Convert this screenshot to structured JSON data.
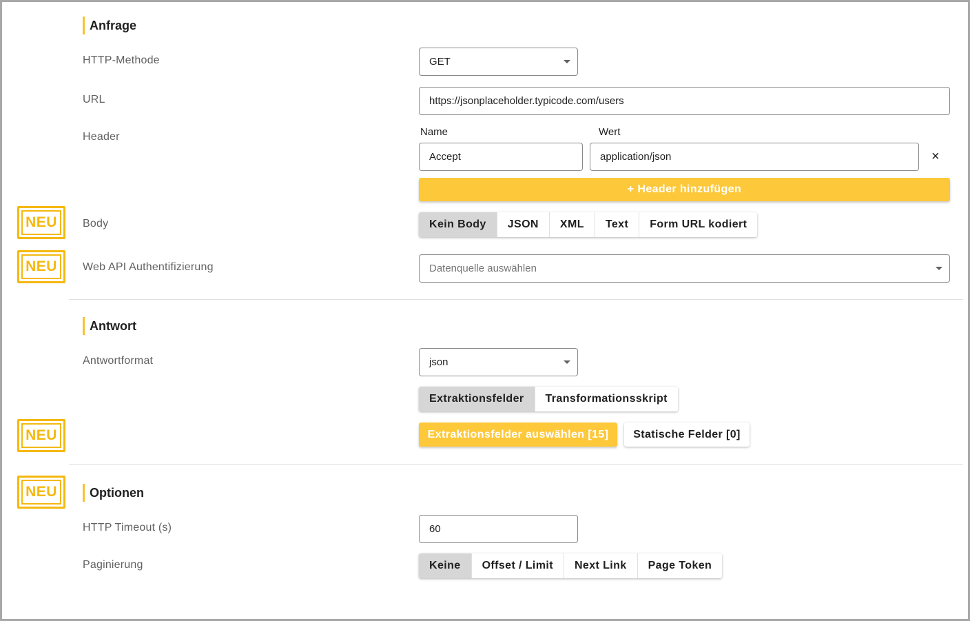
{
  "badge": "NEU",
  "anfrage": {
    "title": "Anfrage",
    "http_method_label": "HTTP-Methode",
    "http_method_value": "GET",
    "url_label": "URL",
    "url_value": "https://jsonplaceholder.typicode.com/users",
    "header_label": "Header",
    "header_name_label": "Name",
    "header_value_label": "Wert",
    "header_name": "Accept",
    "header_value": "application/json",
    "remove_icon": "×",
    "add_header_label": "+ Header hinzufügen",
    "body_label": "Body",
    "body_options": [
      "Kein Body",
      "JSON",
      "XML",
      "Text",
      "Form URL kodiert"
    ],
    "body_selected": "Kein Body",
    "auth_label": "Web API Authentifizierung",
    "auth_placeholder": "Datenquelle auswählen"
  },
  "antwort": {
    "title": "Antwort",
    "format_label": "Antwortformat",
    "format_value": "json",
    "mode_options": [
      "Extraktionsfelder",
      "Transformationsskript"
    ],
    "mode_selected": "Extraktionsfelder",
    "select_fields_label": "Extraktionsfelder auswählen [15]",
    "static_fields_label": "Statische Felder [0]"
  },
  "optionen": {
    "title": "Optionen",
    "timeout_label": "HTTP Timeout (s)",
    "timeout_value": "60",
    "pagination_label": "Paginierung",
    "pagination_options": [
      "Keine",
      "Offset / Limit",
      "Next Link",
      "Page Token"
    ],
    "pagination_selected": "Keine"
  },
  "colors": {
    "accent": "#fdc83a",
    "badge": "#f5b80f",
    "toggle_active": "#d6d6d6"
  }
}
